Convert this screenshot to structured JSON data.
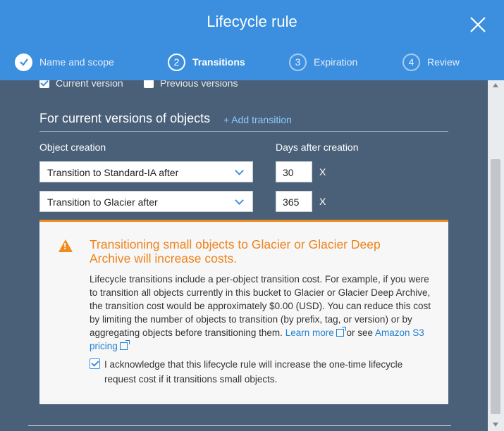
{
  "modal": {
    "title": "Lifecycle rule"
  },
  "steps": [
    {
      "number": "",
      "label": "Name and scope",
      "state": "completed",
      "icon": "check-icon"
    },
    {
      "number": "2",
      "label": "Transitions",
      "state": "active"
    },
    {
      "number": "3",
      "label": "Expiration",
      "state": "upcoming"
    },
    {
      "number": "4",
      "label": "Review",
      "state": "upcoming"
    }
  ],
  "versions": {
    "current": {
      "label": "Current version",
      "checked": true
    },
    "previous": {
      "label": "Previous versions",
      "checked": false
    }
  },
  "section": {
    "title": "For current versions of objects",
    "add_transition": "+ Add transition",
    "col_object_creation": "Object creation",
    "col_days": "Days after creation"
  },
  "transitions": [
    {
      "select": "Transition to Standard-IA after",
      "days": "30",
      "remove": "X"
    },
    {
      "select": "Transition to Glacier after",
      "days": "365",
      "remove": "X"
    }
  ],
  "warning": {
    "title": "Transitioning small objects to Glacier or Glacier Deep Archive will increase costs.",
    "body": "Lifecycle transitions include a per-object transition cost. For example, if you were to transition all objects currently in this bucket to Glacier or Glacier Deep Archive, the transition cost would be approximately $0.00 (USD). You can reduce this cost by limiting the number of objects to transition (by prefix, tag, or version) or by aggregating objects before transitioning them. ",
    "learn_more": "Learn more",
    "or_see": " or see ",
    "pricing_link": "Amazon S3 pricing",
    "acknowledge": "I acknowledge that this lifecycle rule will increase the one-time lifecycle request cost if it transitions small objects.",
    "acknowledged": true
  },
  "colors": {
    "header": "#3c8fde",
    "panel": "#4a6079",
    "warning_accent": "#f08c1e",
    "link": "#1f7fd0"
  }
}
